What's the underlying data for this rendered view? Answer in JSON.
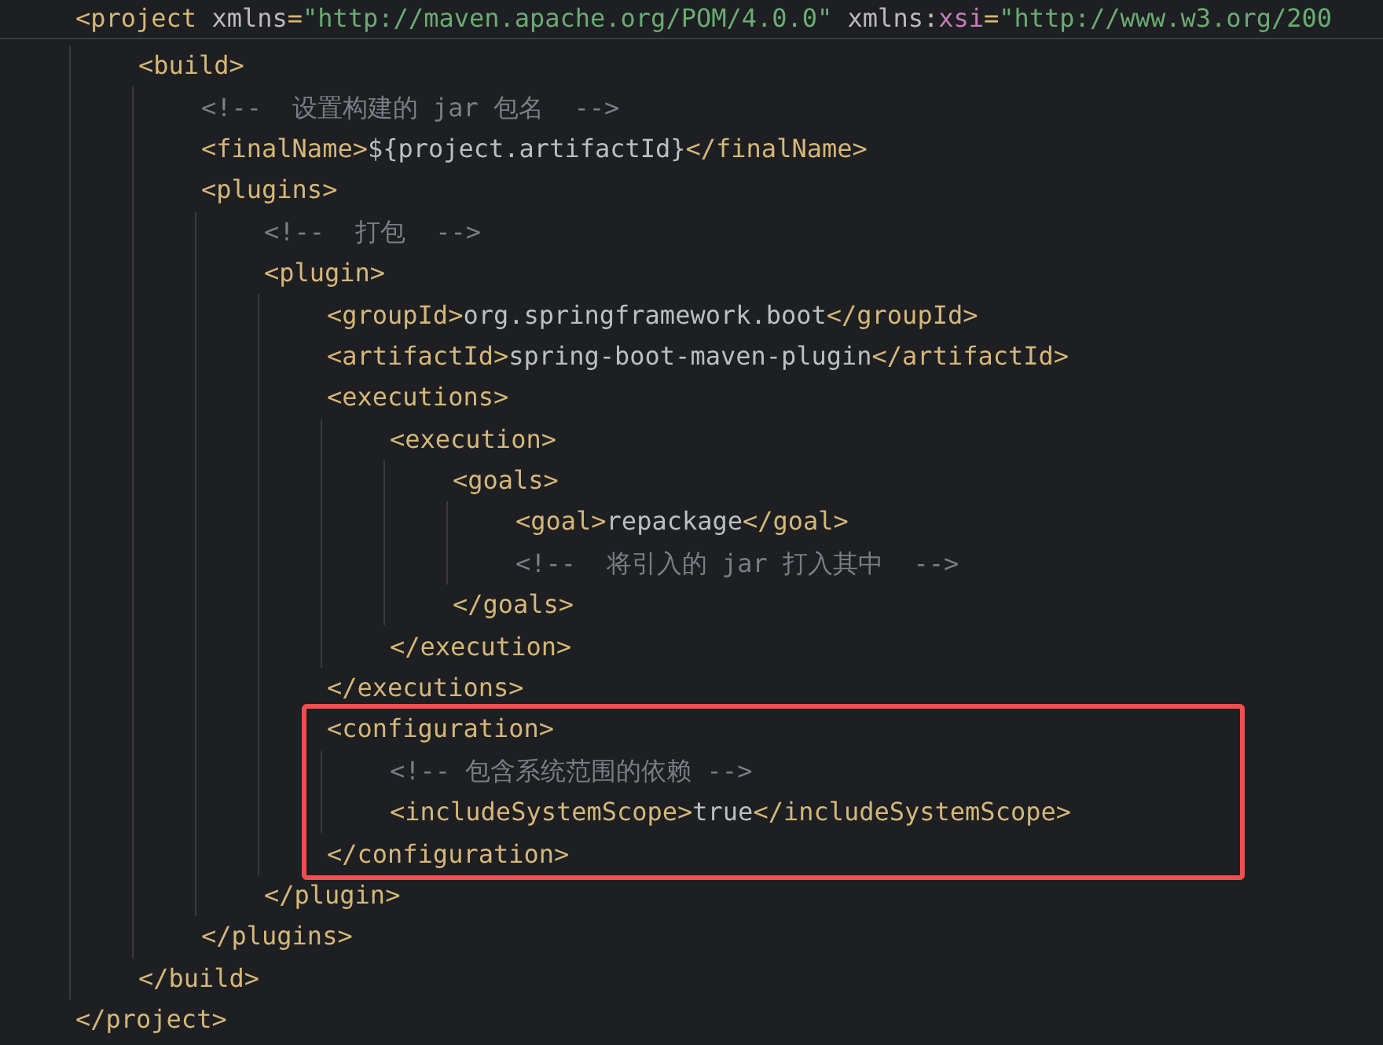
{
  "document": {
    "open": [
      {
        "kind": "tag",
        "text": "<project"
      },
      {
        "kind": "attr",
        "text": " xmlns"
      },
      {
        "kind": "tag",
        "text": "="
      },
      {
        "kind": "string",
        "text": "\"http://maven.apache.org/POM/4.0.0\""
      },
      {
        "kind": "attr",
        "text": " xmlns:"
      },
      {
        "kind": "ns",
        "text": "xsi"
      },
      {
        "kind": "tag",
        "text": "="
      },
      {
        "kind": "string",
        "text": "\"http://www.w3.org/200"
      }
    ],
    "close": [
      {
        "kind": "tag",
        "text": "</project>"
      }
    ],
    "children": [
      {
        "open": [
          {
            "kind": "tag",
            "text": "<build>"
          }
        ],
        "close": [
          {
            "kind": "tag",
            "text": "</build>"
          }
        ],
        "children": [
          {
            "tokens": [
              {
                "kind": "comment",
                "text": "<!--  设置构建的 jar 包名  -->"
              }
            ]
          },
          {
            "tokens": [
              {
                "kind": "tag",
                "text": "<finalName>"
              },
              {
                "kind": "text",
                "text": "${project.artifactId}"
              },
              {
                "kind": "tag",
                "text": "</finalName>"
              }
            ]
          },
          {
            "open": [
              {
                "kind": "tag",
                "text": "<plugins>"
              }
            ],
            "close": [
              {
                "kind": "tag",
                "text": "</plugins>"
              }
            ],
            "children": [
              {
                "tokens": [
                  {
                    "kind": "comment",
                    "text": "<!--  打包  -->"
                  }
                ]
              },
              {
                "open": [
                  {
                    "kind": "tag",
                    "text": "<plugin>"
                  }
                ],
                "close": [
                  {
                    "kind": "tag",
                    "text": "</plugin>"
                  }
                ],
                "children": [
                  {
                    "tokens": [
                      {
                        "kind": "tag",
                        "text": "<groupId>"
                      },
                      {
                        "kind": "text",
                        "text": "org.springframework.boot"
                      },
                      {
                        "kind": "tag",
                        "text": "</groupId>"
                      }
                    ]
                  },
                  {
                    "tokens": [
                      {
                        "kind": "tag",
                        "text": "<artifactId>"
                      },
                      {
                        "kind": "text",
                        "text": "spring-boot-maven-plugin"
                      },
                      {
                        "kind": "tag",
                        "text": "</artifactId>"
                      }
                    ]
                  },
                  {
                    "open": [
                      {
                        "kind": "tag",
                        "text": "<executions>"
                      }
                    ],
                    "close": [
                      {
                        "kind": "tag",
                        "text": "</executions>"
                      }
                    ],
                    "children": [
                      {
                        "open": [
                          {
                            "kind": "tag",
                            "text": "<execution>"
                          }
                        ],
                        "close": [
                          {
                            "kind": "tag",
                            "text": "</execution>"
                          }
                        ],
                        "children": [
                          {
                            "open": [
                              {
                                "kind": "tag",
                                "text": "<goals>"
                              }
                            ],
                            "close": [
                              {
                                "kind": "tag",
                                "text": "</goals>"
                              }
                            ],
                            "children": [
                              {
                                "tokens": [
                                  {
                                    "kind": "tag",
                                    "text": "<goal>"
                                  },
                                  {
                                    "kind": "text",
                                    "text": "repackage"
                                  },
                                  {
                                    "kind": "tag",
                                    "text": "</goal>"
                                  }
                                ]
                              },
                              {
                                "tokens": [
                                  {
                                    "kind": "comment",
                                    "text": "<!--  将引入的 jar 打入其中  -->"
                                  }
                                ]
                              }
                            ]
                          }
                        ]
                      }
                    ]
                  },
                  {
                    "highlighted": true,
                    "open": [
                      {
                        "kind": "tag",
                        "text": "<configuration>"
                      }
                    ],
                    "close": [
                      {
                        "kind": "tag",
                        "text": "</configuration>"
                      }
                    ],
                    "children": [
                      {
                        "tokens": [
                          {
                            "kind": "comment",
                            "text": "<!-- 包含系统范围的依赖 -->"
                          }
                        ]
                      },
                      {
                        "tokens": [
                          {
                            "kind": "tag",
                            "text": "<includeSystemScope>"
                          },
                          {
                            "kind": "text",
                            "text": "true"
                          },
                          {
                            "kind": "tag",
                            "text": "</includeSystemScope>"
                          }
                        ]
                      }
                    ]
                  }
                ]
              }
            ]
          }
        ]
      }
    ]
  }
}
